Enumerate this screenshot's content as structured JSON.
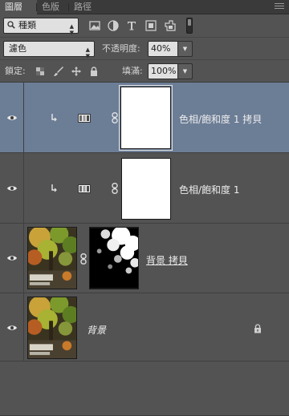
{
  "tabs": [
    {
      "label": "圖層",
      "active": true
    },
    {
      "label": "色版",
      "active": false
    },
    {
      "label": "路徑",
      "active": false
    }
  ],
  "filter": {
    "kind_label": "種類",
    "icons": [
      "pixel-filter-icon",
      "adjustment-filter-icon",
      "type-filter-icon",
      "shape-filter-icon",
      "smart-object-filter-icon"
    ]
  },
  "blend": {
    "mode": "濾色",
    "opacity_label": "不透明度:",
    "opacity_value": "40%"
  },
  "lock": {
    "label": "鎖定:",
    "fill_label": "填滿:",
    "fill_value": "100%"
  },
  "layers": [
    {
      "name": "色相/飽和度 1 拷貝",
      "type": "adjustment",
      "selected": true,
      "visible": true
    },
    {
      "name": "色相/飽和度 1",
      "type": "adjustment",
      "selected": false,
      "visible": true
    },
    {
      "name": "背景 拷貝",
      "type": "pixel-with-mask",
      "selected": false,
      "visible": true
    },
    {
      "name": "背景",
      "type": "background",
      "selected": false,
      "visible": true,
      "locked": true
    }
  ],
  "colors": {
    "panel_bg": "#535353",
    "selected_row": "#6c7d96",
    "tab_bar": "#3a3a3a"
  }
}
